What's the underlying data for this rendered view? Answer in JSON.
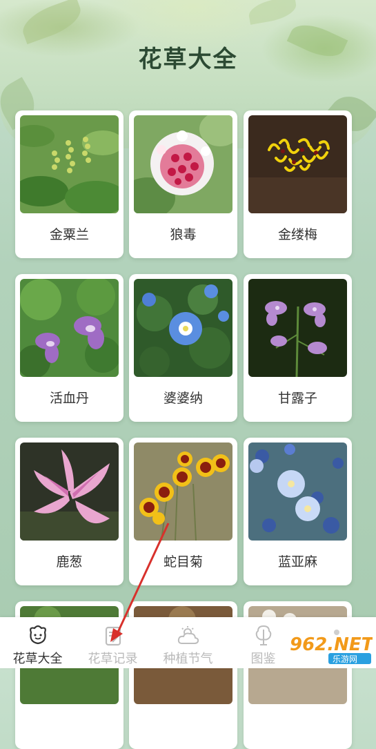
{
  "header": {
    "title": "花草大全"
  },
  "plants": [
    {
      "name": "金粟兰"
    },
    {
      "name": "狼毒"
    },
    {
      "name": "金缕梅"
    },
    {
      "name": "活血丹"
    },
    {
      "name": "婆婆纳"
    },
    {
      "name": "甘露子"
    },
    {
      "name": "鹿葱"
    },
    {
      "name": "蛇目菊"
    },
    {
      "name": "蓝亚麻"
    }
  ],
  "tabs": [
    {
      "label": "花草大全",
      "icon": "flower-face-icon",
      "active": true
    },
    {
      "label": "花草记录",
      "icon": "notebook-icon",
      "active": false
    },
    {
      "label": "种植节气",
      "icon": "weather-cloud-icon",
      "active": false
    },
    {
      "label": "图鉴",
      "icon": "plant-book-icon",
      "active": false
    }
  ],
  "watermark": {
    "text_primary": "962.NET",
    "text_secondary": "乐游网"
  },
  "colors": {
    "accent_text": "#2c4a33",
    "annotation_arrow": "#d8312c"
  }
}
